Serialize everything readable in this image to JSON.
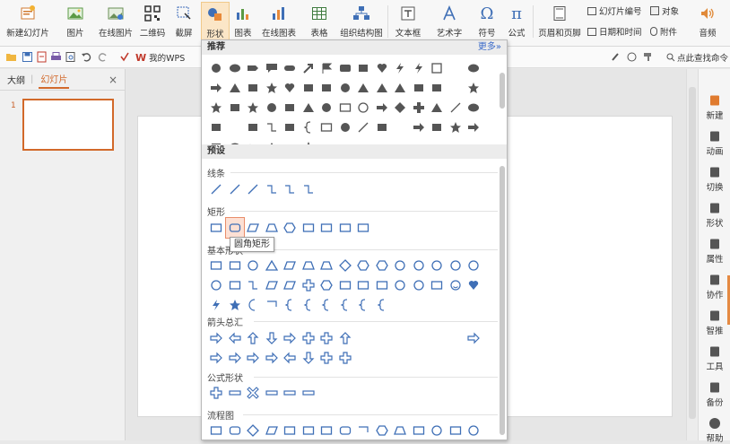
{
  "ribbon": {
    "new_slide": "新建幻灯片",
    "picture": "图片",
    "online_picture": "在线图片",
    "qrcode": "二维码",
    "screenshot": "截屏",
    "shapes": "形状",
    "chart": "图表",
    "online_chart": "在线图表",
    "table": "表格",
    "org_chart": "组织结构图",
    "textbox": "文本框",
    "wordart": "艺术字",
    "symbol": "符号",
    "formula": "公式",
    "header_footer": "页眉和页脚",
    "slide_number": "幻灯片编号",
    "object": "对象",
    "date_time": "日期和时间",
    "attachment": "附件",
    "audio": "音频"
  },
  "quickbar": {
    "my_wps": "我的WPS",
    "search_cmd": "点此查找命令"
  },
  "leftpanel": {
    "tab_outline": "大纲",
    "tab_slides": "幻灯片",
    "close": "×",
    "slide_number": "1"
  },
  "rightbar": {
    "items": [
      "新建",
      "动画",
      "切换",
      "形状",
      "属性",
      "协作",
      "智推",
      "工具",
      "备份",
      "帮助"
    ]
  },
  "shapes_panel": {
    "recommended": "推荐",
    "more": "更多»",
    "preset": "预设",
    "lines": "线条",
    "rectangles": "矩形",
    "basic_shapes": "基本形状",
    "block_arrows": "箭头总汇",
    "equation_shapes": "公式形状",
    "flowchart": "流程图",
    "tooltip": "圆角矩形"
  },
  "colors": {
    "accent": "#d2692a",
    "shape_gray": "#555555",
    "preset_blue": "#3f6fb6"
  }
}
